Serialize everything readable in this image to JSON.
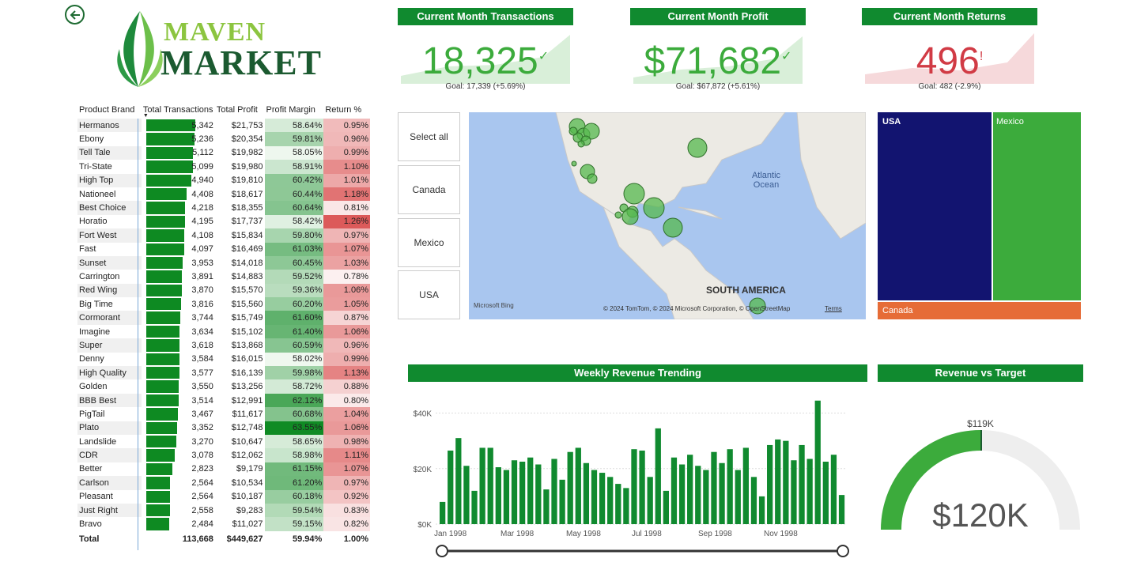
{
  "nav": {
    "back_icon": "back-arrow-icon"
  },
  "logo": {
    "line1": "MAVEN",
    "line2": "MARKET",
    "icon": "leaf-icon"
  },
  "kpis": [
    {
      "title": "Current Month Transactions",
      "value": "18,325",
      "indicator": "✓",
      "goal": "Goal: 17,339 (+5.69%)",
      "color": "#3cab3c"
    },
    {
      "title": "Current Month Profit",
      "value": "$71,682",
      "indicator": "✓",
      "goal": "Goal: $67,872 (+5.61%)",
      "color": "#3cab3c"
    },
    {
      "title": "Current Month Returns",
      "value": "496",
      "indicator": "!",
      "goal": "Goal: 482 (-2.9%)",
      "color": "#d13b45"
    }
  ],
  "table": {
    "headers": [
      "Product Brand",
      "Total Transactions",
      "Total Profit",
      "Profit Margin",
      "Return %"
    ],
    "rows": [
      [
        "Hermanos",
        "5,342",
        "$21,753",
        "58.64%",
        "0.95%"
      ],
      [
        "Ebony",
        "5,236",
        "$20,354",
        "59.81%",
        "0.96%"
      ],
      [
        "Tell Tale",
        "5,112",
        "$19,982",
        "58.05%",
        "0.99%"
      ],
      [
        "Tri-State",
        "5,099",
        "$19,980",
        "58.91%",
        "1.10%"
      ],
      [
        "High Top",
        "4,940",
        "$19,810",
        "60.42%",
        "1.01%"
      ],
      [
        "Nationeel",
        "4,408",
        "$18,617",
        "60.44%",
        "1.18%"
      ],
      [
        "Best Choice",
        "4,218",
        "$18,355",
        "60.64%",
        "0.81%"
      ],
      [
        "Horatio",
        "4,195",
        "$17,737",
        "58.42%",
        "1.26%"
      ],
      [
        "Fort West",
        "4,108",
        "$15,834",
        "59.80%",
        "0.97%"
      ],
      [
        "Fast",
        "4,097",
        "$16,469",
        "61.03%",
        "1.07%"
      ],
      [
        "Sunset",
        "3,953",
        "$14,018",
        "60.45%",
        "1.03%"
      ],
      [
        "Carrington",
        "3,891",
        "$14,883",
        "59.52%",
        "0.78%"
      ],
      [
        "Red Wing",
        "3,870",
        "$15,570",
        "59.36%",
        "1.06%"
      ],
      [
        "Big Time",
        "3,816",
        "$15,560",
        "60.20%",
        "1.05%"
      ],
      [
        "Cormorant",
        "3,744",
        "$15,749",
        "61.60%",
        "0.87%"
      ],
      [
        "Imagine",
        "3,634",
        "$15,102",
        "61.40%",
        "1.06%"
      ],
      [
        "Super",
        "3,618",
        "$13,868",
        "60.59%",
        "0.96%"
      ],
      [
        "Denny",
        "3,584",
        "$16,015",
        "58.02%",
        "0.99%"
      ],
      [
        "High Quality",
        "3,577",
        "$16,139",
        "59.98%",
        "1.13%"
      ],
      [
        "Golden",
        "3,550",
        "$13,256",
        "58.72%",
        "0.88%"
      ],
      [
        "BBB Best",
        "3,514",
        "$12,991",
        "62.12%",
        "0.80%"
      ],
      [
        "PigTail",
        "3,467",
        "$11,617",
        "60.68%",
        "1.04%"
      ],
      [
        "Plato",
        "3,352",
        "$12,748",
        "63.55%",
        "1.06%"
      ],
      [
        "Landslide",
        "3,270",
        "$10,647",
        "58.65%",
        "0.98%"
      ],
      [
        "CDR",
        "3,078",
        "$12,062",
        "58.98%",
        "1.11%"
      ],
      [
        "Better",
        "2,823",
        "$9,179",
        "61.15%",
        "1.07%"
      ],
      [
        "Carlson",
        "2,564",
        "$10,534",
        "61.20%",
        "0.97%"
      ],
      [
        "Pleasant",
        "2,564",
        "$10,187",
        "60.18%",
        "0.92%"
      ],
      [
        "Just Right",
        "2,558",
        "$9,283",
        "59.54%",
        "0.83%"
      ],
      [
        "Bravo",
        "2,484",
        "$11,027",
        "59.15%",
        "0.82%"
      ]
    ],
    "total": [
      "Total",
      "113,668",
      "$449,627",
      "59.94%",
      "1.00%"
    ]
  },
  "slicer": {
    "items": [
      "Select all",
      "Canada",
      "Mexico",
      "USA"
    ]
  },
  "map": {
    "ocean_label": "Atlantic Ocean",
    "continent_label": "SOUTH AMERICA",
    "attribution": "© 2024 TomTom, © 2024 Microsoft Corporation, © OpenStreetMap",
    "terms": "Terms",
    "bing": "Microsoft Bing"
  },
  "treemap": {
    "items": [
      {
        "label": "USA",
        "color": "#121470"
      },
      {
        "label": "Mexico",
        "color": "#3cab3c"
      },
      {
        "label": "Canada",
        "color": "#e66c37"
      }
    ]
  },
  "weekly": {
    "title": "Weekly Revenue Trending"
  },
  "gauge": {
    "title": "Revenue vs Target",
    "value": "$120K",
    "target": "$119K",
    "fill_fraction": 0.5
  },
  "chart_data": {
    "type": "bar",
    "title": "Weekly Revenue Trending",
    "ylim": [
      0,
      45000
    ],
    "yticks": [
      "$0K",
      "$20K",
      "$40K"
    ],
    "xticks": [
      "Jan 1998",
      "Mar 1998",
      "May 1998",
      "Jul 1998",
      "Sep 1998",
      "Nov 1998"
    ],
    "values": [
      8000,
      26500,
      31000,
      21000,
      12000,
      27500,
      27500,
      20500,
      19500,
      23000,
      22500,
      24000,
      21500,
      12500,
      23500,
      16000,
      26000,
      27500,
      22000,
      19500,
      18500,
      17000,
      14500,
      13000,
      27000,
      26500,
      17000,
      34500,
      12000,
      24000,
      21500,
      25000,
      21000,
      19500,
      26000,
      22000,
      27000,
      19500,
      27500,
      17000,
      10000,
      28500,
      30500,
      30000,
      23000,
      28500,
      23500,
      44500,
      22500,
      25000,
      10500
    ],
    "color": "#108a2f"
  }
}
